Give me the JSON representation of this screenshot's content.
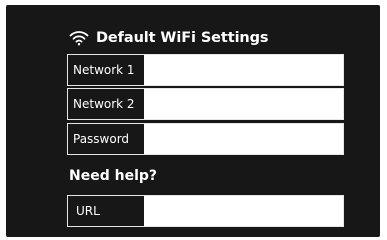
{
  "header": {
    "title": "Default WiFi Settings",
    "icon": "wifi-icon"
  },
  "fields": {
    "network1": {
      "label": "Network 1",
      "value": ""
    },
    "network2": {
      "label": "Network 2",
      "value": ""
    },
    "password": {
      "label": "Password",
      "value": ""
    }
  },
  "help": {
    "heading": "Need help?",
    "url": {
      "label": "URL",
      "value": ""
    }
  },
  "colors": {
    "panel_background": "#171717",
    "text": "#ffffff",
    "input_background": "#ffffff",
    "field_border": "#e6e6e6"
  }
}
